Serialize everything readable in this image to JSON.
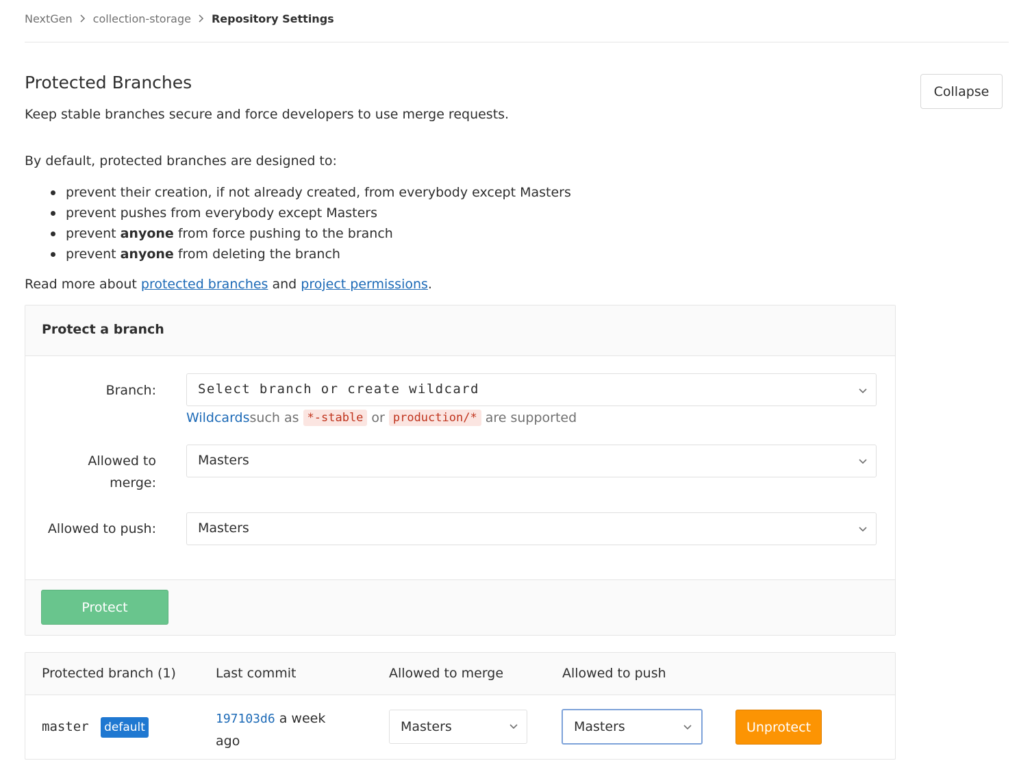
{
  "breadcrumb": {
    "items": [
      "NextGen",
      "collection-storage"
    ],
    "current": "Repository Settings"
  },
  "section": {
    "title": "Protected Branches",
    "description": "Keep stable branches secure and force developers to use merge requests.",
    "collapse_label": "Collapse",
    "intro": "By default, protected branches are designed to:",
    "bullets": [
      {
        "pre": "prevent their creation, if not already created, from everybody except Masters",
        "bold": "",
        "post": ""
      },
      {
        "pre": "prevent pushes from everybody except Masters",
        "bold": "",
        "post": ""
      },
      {
        "pre": "prevent ",
        "bold": "anyone",
        "post": " from force pushing to the branch"
      },
      {
        "pre": "prevent ",
        "bold": "anyone",
        "post": " from deleting the branch"
      }
    ],
    "readmore": {
      "prefix": "Read more about ",
      "link1": "protected branches",
      "middle": " and ",
      "link2": "project permissions",
      "suffix": "."
    }
  },
  "protect_form": {
    "title": "Protect a branch",
    "branch_label": "Branch:",
    "branch_placeholder": "Select branch or create wildcard",
    "help": {
      "link": "Wildcards",
      "t1": " such as",
      "code1": "*-stable",
      "t2": "or",
      "code2": "production/*",
      "t3": "are supported"
    },
    "merge_label_line1": "Allowed to",
    "merge_label_line2": "merge:",
    "merge_value": "Masters",
    "push_label": "Allowed to push:",
    "push_value": "Masters",
    "protect_button": "Protect"
  },
  "table": {
    "headers": {
      "branch": "Protected branch (1)",
      "commit": "Last commit",
      "merge": "Allowed to merge",
      "push": "Allowed to push"
    },
    "rows": [
      {
        "branch": "master",
        "badge": "default",
        "commit_sha": "197103d6",
        "commit_time": " a week ago",
        "merge": "Masters",
        "push": "Masters",
        "action": "Unprotect"
      }
    ]
  },
  "colors": {
    "link": "#1b69b6",
    "protect_button": "#69c58d",
    "unprotect_button": "#fc9403",
    "badge": "#1f78d1",
    "code_text": "#c0341d"
  },
  "icons": {
    "breadcrumb_separator": "chevron-right-icon",
    "dropdown": "chevron-down-icon"
  }
}
